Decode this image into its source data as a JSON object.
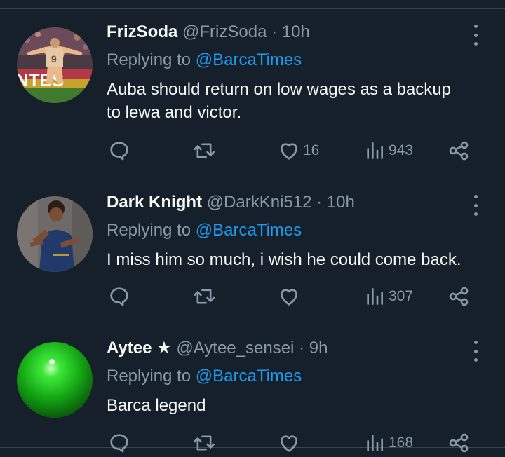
{
  "tweets": [
    {
      "name": "FrizSoda",
      "handle": "@FrizSoda",
      "separator": "·",
      "time": "10h",
      "replying_prefix": "Replying to",
      "replying_to": "@BarcaTimes",
      "text": "Auba should return on low wages as a backup to lewa and victor.",
      "avatar_text": "NTES",
      "avatar_jersey_number": "9",
      "likes": "16",
      "views": "943"
    },
    {
      "name": "Dark Knight",
      "handle": "@DarkKni512",
      "separator": "·",
      "time": "10h",
      "replying_prefix": "Replying to",
      "replying_to": "@BarcaTimes",
      "text": "I miss him so much, i wish he could come back.",
      "likes": "",
      "views": "307"
    },
    {
      "name": "Aytee",
      "badge": "★",
      "handle": "@Aytee_sensei",
      "separator": "·",
      "time": "9h",
      "replying_prefix": "Replying to",
      "replying_to": "@BarcaTimes",
      "text": "Barca legend",
      "likes": "",
      "views": "168"
    }
  ],
  "icons": {
    "reply": "reply-icon",
    "retweet": "retweet-icon",
    "like": "heart-icon",
    "views": "views-icon",
    "share": "share-icon",
    "more": "more-icon"
  },
  "colors": {
    "background": "#15202b",
    "text": "#f7f9f9",
    "muted": "#8b98a5",
    "link": "#1d9bf0",
    "divider": "#38444d"
  }
}
